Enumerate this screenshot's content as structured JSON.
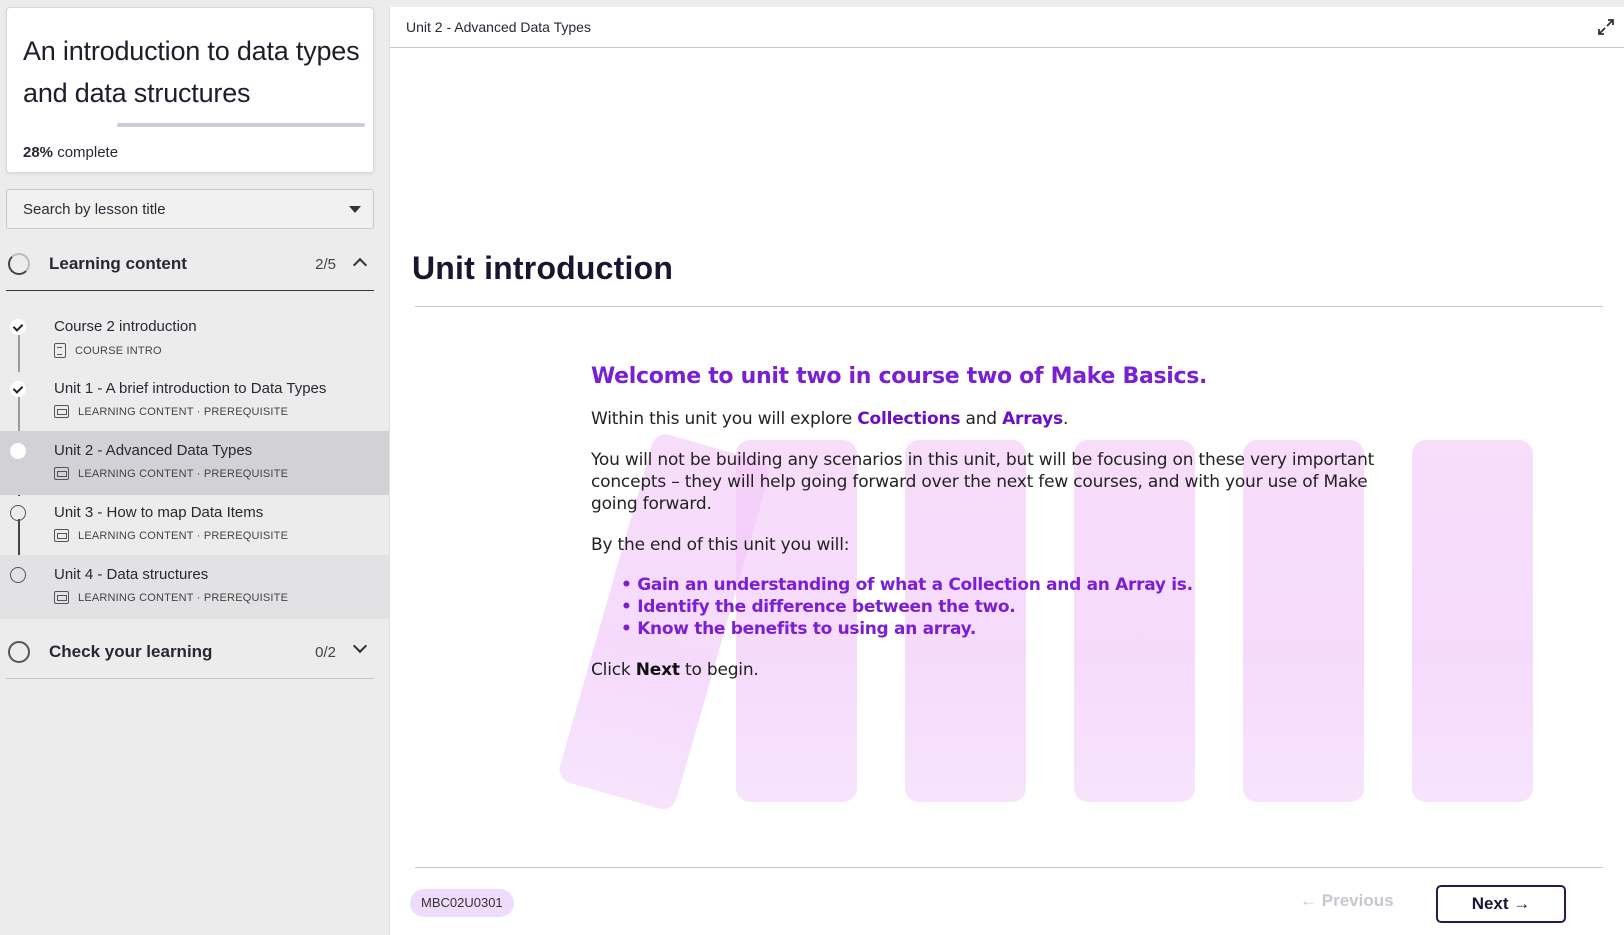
{
  "course": {
    "title": "An introduction to data types and data structures",
    "progress_value": "28%",
    "progress_suffix": "complete",
    "progress_fraction": 0.28
  },
  "search": {
    "placeholder": "Search by lesson title"
  },
  "sections": [
    {
      "label": "Learning content",
      "count": "2/5",
      "expanded": true
    },
    {
      "label": "Check your learning",
      "count": "0/2",
      "expanded": false
    }
  ],
  "lessons": [
    {
      "title": "Course 2 introduction",
      "meta": "COURSE INTRO",
      "status": "done"
    },
    {
      "title": "Unit 1 - A brief introduction to Data Types",
      "meta": "LEARNING CONTENT · PREREQUISITE",
      "status": "done"
    },
    {
      "title": "Unit 2 - Advanced Data Types",
      "meta": "LEARNING CONTENT · PREREQUISITE",
      "status": "current"
    },
    {
      "title": "Unit 3 - How to map Data Items",
      "meta": "LEARNING CONTENT · PREREQUISITE",
      "status": "todo"
    },
    {
      "title": "Unit 4 - Data structures",
      "meta": "LEARNING CONTENT · PREREQUISITE",
      "status": "todo"
    }
  ],
  "main": {
    "topbar_title": "Unit 2 - Advanced Data Types",
    "heading": "Unit introduction",
    "welcome": "Welcome to unit two in course two of Make Basics.",
    "p1_before": "Within this unit you will explore ",
    "p1_hl1": "Collections",
    "p1_mid": " and ",
    "p1_hl2": "Arrays",
    "p1_after": ".",
    "p2": "You will not be building any scenarios in this unit, but will be focusing on these very important concepts – they will help going forward over the next few courses, and with your use of Make going forward.",
    "p3": "By the end of this unit you will:",
    "bullets": [
      "Gain an understanding of what a Collection and an Array is.",
      "Identify the difference between the two.",
      "Know the benefits to using an array."
    ],
    "p4_before": "Click ",
    "p4_bold": "Next",
    "p4_after": " to begin.",
    "lesson_code": "MBC02U0301",
    "prev_label": "Previous",
    "next_label": "Next"
  },
  "colors": {
    "accent_purple": "#7a1fd2",
    "heading_dark": "#1b1630",
    "badge_bg": "#efdcfc",
    "bars_pink": "#f5c9f7"
  },
  "icons": [
    "check-icon",
    "chevron-up-icon",
    "chevron-down-icon",
    "dropdown-caret-icon",
    "expand-icon",
    "arrow-left-icon",
    "arrow-right-icon",
    "lesson-type-icon"
  ]
}
